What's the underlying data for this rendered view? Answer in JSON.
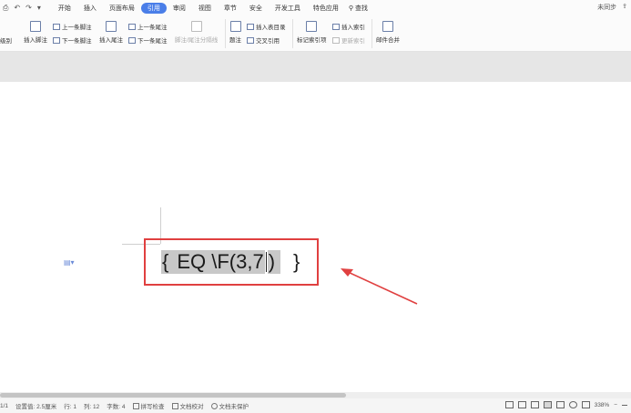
{
  "menubar": {
    "quick_access": [
      "↶",
      "↷",
      "▾"
    ],
    "tabs": [
      "开始",
      "插入",
      "页面布局",
      "引用",
      "审阅",
      "视图",
      "章节",
      "安全",
      "开发工具",
      "特色应用"
    ],
    "active_tab": "引用",
    "search_label": "查找",
    "sync_status": "未同步"
  },
  "ribbon": {
    "cut_label": "级别",
    "insert_footnote": "插入脚注",
    "prev_footnote": "上一条脚注",
    "next_footnote": "下一条脚注",
    "insert_endnote": "插入尾注",
    "prev_endnote": "上一条尾注",
    "next_endnote": "下一条尾注",
    "footnote_separator": "脚注/尾注分隔线",
    "caption": "题注",
    "insert_toc": "插入表目录",
    "cross_ref": "交叉引用",
    "mark_index": "标记索引项",
    "insert_index": "插入索引",
    "update_index": "更新索引",
    "mail_merge": "邮件合并"
  },
  "document": {
    "field_open": "{",
    "field_code": "EQ \\F(3,7",
    "field_tail": ")",
    "field_close": "}"
  },
  "status_bar": {
    "page": "1/1",
    "setting": "设置值: 2.5厘米",
    "row": "行: 1",
    "col": "列: 12",
    "chars": "字数: 4",
    "spell": "拼写检查",
    "proof": "文档校对",
    "protect": "文档未保护",
    "zoom": "338%"
  },
  "colors": {
    "accent": "#4a7ee8",
    "highlight_box": "#e04040"
  }
}
